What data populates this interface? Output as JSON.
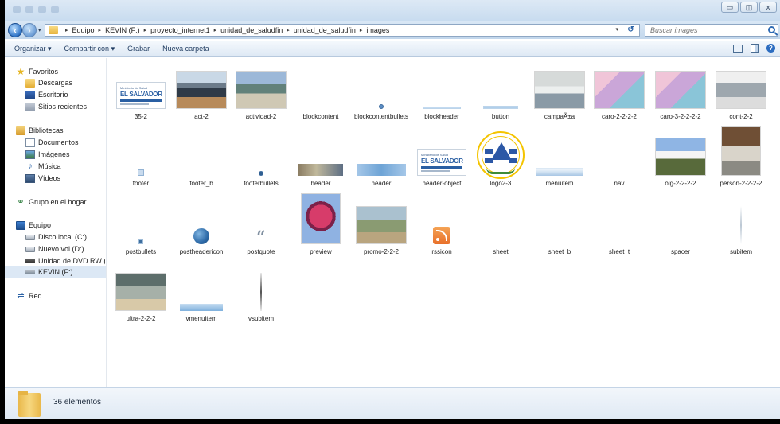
{
  "window": {
    "controls": {
      "minimize": "▭",
      "maximize": "◫",
      "close": "ⅹ"
    }
  },
  "nav": {
    "back_icon": "back-arrow-icon",
    "forward_icon": "forward-arrow-icon",
    "breadcrumb": [
      "Equipo",
      "KEVIN (F:)",
      "proyecto_internet1",
      "unidad_de_saludfin",
      "unidad_de_saludfin",
      "images"
    ],
    "refresh_symbol": "↺",
    "search_placeholder": "Buscar images"
  },
  "toolbar": {
    "organize": "Organizar ▾",
    "share": "Compartir con ▾",
    "burn": "Grabar",
    "new_folder": "Nueva carpeta"
  },
  "sidebar": {
    "favorites": "Favoritos",
    "favorites_items": [
      "Descargas",
      "Escritorio",
      "Sitios recientes"
    ],
    "libraries": "Bibliotecas",
    "libraries_items": [
      "Documentos",
      "Imágenes",
      "Música",
      "Vídeos"
    ],
    "homegroup": "Grupo en el hogar",
    "computer": "Equipo",
    "computer_items": [
      "Disco local (C:)",
      "Nuevo vol (D:)",
      "Unidad de DVD RW (",
      "KEVIN (F:)"
    ],
    "network": "Red"
  },
  "files": [
    {
      "name": "35-2",
      "thumb": "logo-el-salvador"
    },
    {
      "name": "act-2",
      "thumb": "photo"
    },
    {
      "name": "actividad-2",
      "thumb": "photo"
    },
    {
      "name": "blockcontent",
      "thumb": "blank"
    },
    {
      "name": "blockcontentbullets",
      "thumb": "dot"
    },
    {
      "name": "blockheader",
      "thumb": "bar"
    },
    {
      "name": "button",
      "thumb": "bar"
    },
    {
      "name": "campaÃ±a",
      "thumb": "photo"
    },
    {
      "name": "caro-2-2-2-2",
      "thumb": "photo"
    },
    {
      "name": "caro-3-2-2-2-2",
      "thumb": "photo"
    },
    {
      "name": "cont-2-2",
      "thumb": "photo"
    },
    {
      "name": "footer",
      "thumb": "square"
    },
    {
      "name": "footer_b",
      "thumb": "blank"
    },
    {
      "name": "footerbullets",
      "thumb": "dot"
    },
    {
      "name": "header",
      "thumb": "banner"
    },
    {
      "name": "header",
      "thumb": "bar"
    },
    {
      "name": "header-object",
      "thumb": "logo-el-salvador"
    },
    {
      "name": "logo2-3",
      "thumb": "seal"
    },
    {
      "name": "menuitem",
      "thumb": "bar"
    },
    {
      "name": "nav",
      "thumb": "blank"
    },
    {
      "name": "olg-2-2-2-2",
      "thumb": "photo"
    },
    {
      "name": "person-2-2-2-2",
      "thumb": "photo"
    },
    {
      "name": "postbullets",
      "thumb": "square"
    },
    {
      "name": "postheadericon",
      "thumb": "ball"
    },
    {
      "name": "postquote",
      "thumb": "quote"
    },
    {
      "name": "preview",
      "thumb": "photo"
    },
    {
      "name": "promo-2-2-2",
      "thumb": "photo"
    },
    {
      "name": "rssicon",
      "thumb": "rss"
    },
    {
      "name": "sheet",
      "thumb": "blank"
    },
    {
      "name": "sheet_b",
      "thumb": "blank"
    },
    {
      "name": "sheet_t",
      "thumb": "blank"
    },
    {
      "name": "spacer",
      "thumb": "blank"
    },
    {
      "name": "subitem",
      "thumb": "vline"
    },
    {
      "name": "ultra-2-2-2",
      "thumb": "photo"
    },
    {
      "name": "vmenuitem",
      "thumb": "bar"
    },
    {
      "name": "vsubitem",
      "thumb": "vline"
    }
  ],
  "thumb_text": {
    "ministry": "Ministerio de Salud",
    "country": "EL SALVADOR"
  },
  "status": {
    "count": "36 elementos"
  }
}
